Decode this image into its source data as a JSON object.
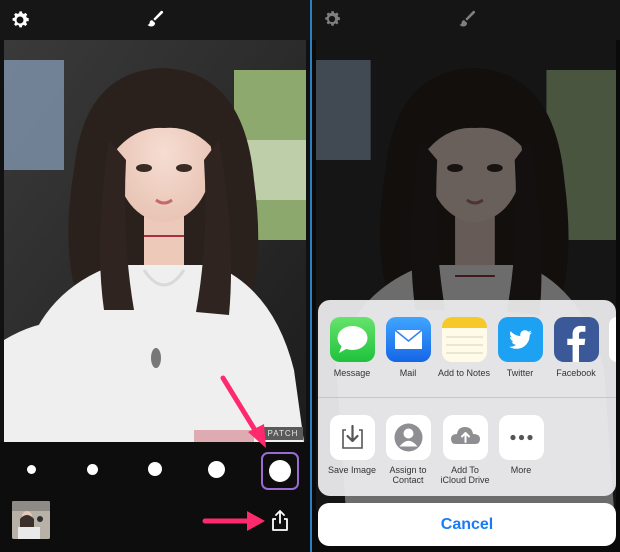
{
  "left": {
    "patch_label": "PATCH",
    "brush_sizes": [
      "extra-small",
      "small",
      "medium",
      "large",
      "extra-large"
    ],
    "selected_brush": "extra-large",
    "accent": "#9a6bd1",
    "annotation_color": "#ff2a6d"
  },
  "share_sheet": {
    "apps": [
      {
        "label": "Message",
        "icon": "messages-icon"
      },
      {
        "label": "Mail",
        "icon": "mail-icon"
      },
      {
        "label": "Add to Notes",
        "icon": "notes-icon"
      },
      {
        "label": "Twitter",
        "icon": "twitter-icon"
      },
      {
        "label": "Facebook",
        "icon": "facebook-icon"
      }
    ],
    "actions": [
      {
        "label": "Save Image",
        "icon": "save-image-icon"
      },
      {
        "label": "Assign to\nContact",
        "icon": "contact-icon"
      },
      {
        "label": "Add To\niCloud Drive",
        "icon": "icloud-icon"
      },
      {
        "label": "More",
        "icon": "more-icon"
      }
    ],
    "cancel_label": "Cancel",
    "cancel_color": "#1a7cf5"
  }
}
